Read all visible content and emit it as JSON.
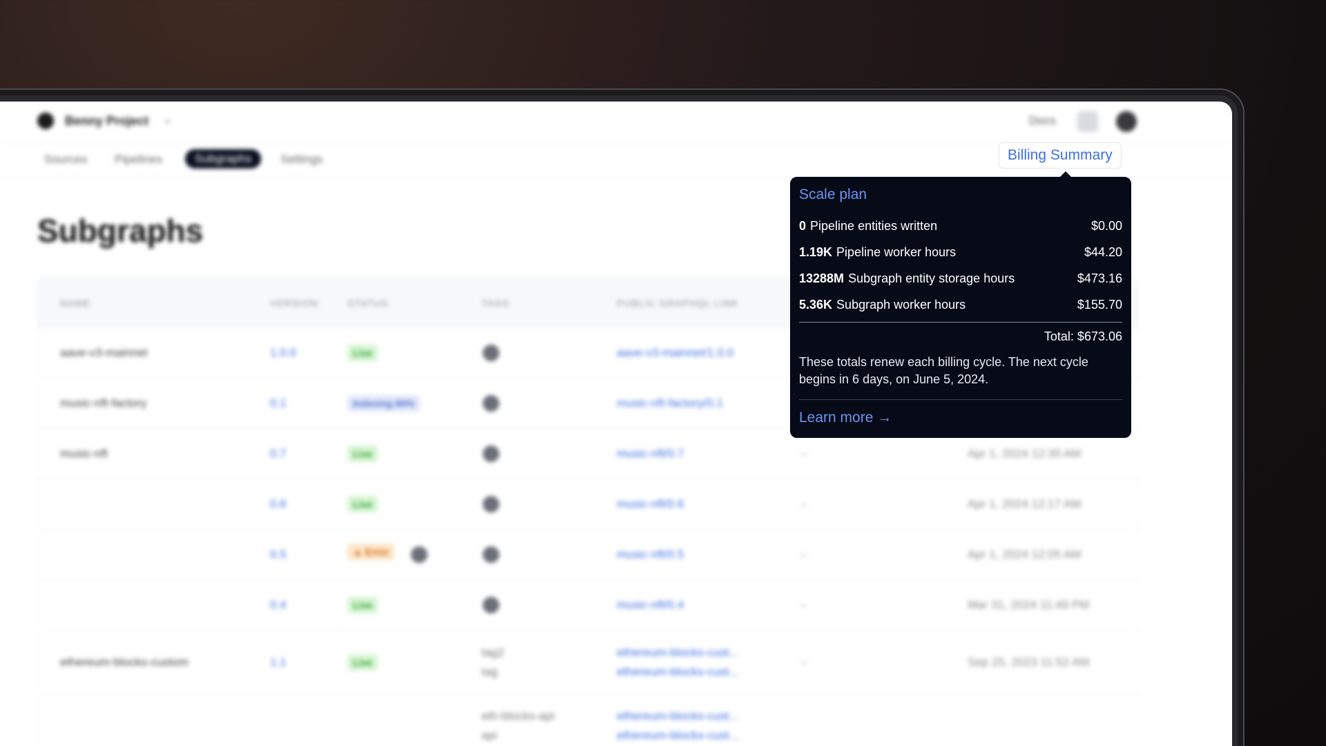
{
  "topbar": {
    "project_name": "Benny Project",
    "docs_label": "Docs"
  },
  "nav": {
    "items": [
      "Sources",
      "Pipelines",
      "Subgraphs",
      "Settings"
    ],
    "active": "Subgraphs"
  },
  "page": {
    "title": "Subgraphs"
  },
  "table": {
    "headers": [
      "NAME",
      "VERSION",
      "STATUS",
      "TAGS",
      "PUBLIC GRAPHQL LINK"
    ],
    "rows": [
      {
        "name": "aave-v3-mainnet",
        "version": "1.0.0",
        "status": "Live",
        "link": "aave-v3-mainnet/1.0.0",
        "dash": "",
        "date": ""
      },
      {
        "name": "music-nft-factory",
        "version": "0.1",
        "status": "Indexing 80%",
        "link": "music-nft-factory/0.1",
        "dash": "",
        "date": ""
      },
      {
        "name": "music-nft",
        "version": "0.7",
        "status": "Live",
        "link": "music-nft/0.7",
        "dash": "–",
        "date": "Apr 1, 2024 12:30 AM"
      },
      {
        "name": "",
        "version": "0.6",
        "status": "Live",
        "link": "music-nft/0.6",
        "dash": "–",
        "date": "Apr 1, 2024 12:17 AM"
      },
      {
        "name": "",
        "version": "0.5",
        "status": "Error",
        "link": "music-nft/0.5",
        "dash": "–",
        "date": "Apr 1, 2024 12:05 AM"
      },
      {
        "name": "",
        "version": "0.4",
        "status": "Live",
        "link": "music-nft/0.4",
        "dash": "–",
        "date": "Mar 31, 2024 11:49 PM"
      },
      {
        "name": "ethereum-blocks-custom",
        "version": "1.1",
        "status": "Live",
        "tags": [
          "tag2",
          "tag"
        ],
        "links": [
          "ethereum-blocks-cust...",
          "ethereum-blocks-cust..."
        ],
        "dash": "–",
        "date": "Sep 25, 2023 11:52 AM"
      },
      {
        "name": "",
        "version": "",
        "status": "",
        "tags": [
          "eth-blocks-api",
          "api"
        ],
        "links": [
          "ethereum-blocks-cust...",
          "ethereum-blocks-cust..."
        ],
        "dash": "",
        "date": ""
      }
    ]
  },
  "billing": {
    "button_label": "Billing Summary",
    "plan": "Scale plan",
    "lines": [
      {
        "qty": "0",
        "label": "Pipeline entities written",
        "amount": "$0.00"
      },
      {
        "qty": "1.19K",
        "label": "Pipeline worker hours",
        "amount": "$44.20"
      },
      {
        "qty": "13288M",
        "label": "Subgraph entity storage hours",
        "amount": "$473.16"
      },
      {
        "qty": "5.36K",
        "label": "Subgraph worker hours",
        "amount": "$155.70"
      }
    ],
    "total": "Total: $673.06",
    "note": "These totals renew each billing cycle. The next cycle begins in 6 days, on June 5, 2024.",
    "learn_more": "Learn more →"
  },
  "colors": {
    "accent": "#3d6fe0",
    "popover_bg": "#070b18",
    "live_bg": "#d8f5d4",
    "error_bg": "#fde5c8"
  }
}
